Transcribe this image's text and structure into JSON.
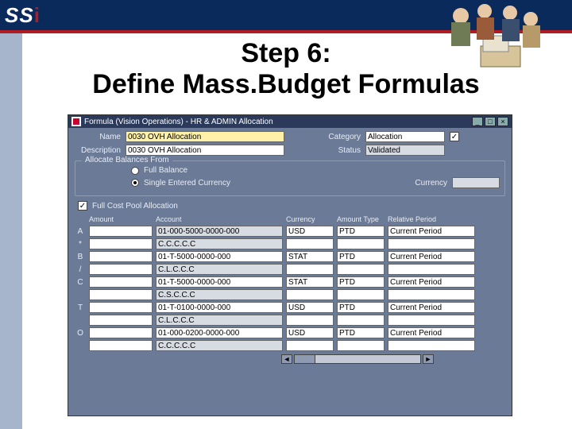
{
  "slide": {
    "logo": "SSi",
    "title_line1": "Step 6:",
    "title_line2": "Define Mass.Budget Formulas"
  },
  "window": {
    "title": "Formula (Vision Operations) - HR & ADMIN Allocation",
    "min": "_",
    "max": "□",
    "close": "×"
  },
  "header": {
    "name_label": "Name",
    "name_value": "0030 OVH Allocation",
    "category_label": "Category",
    "category_value": "Allocation",
    "description_label": "Description",
    "description_value": "0030 OVH Allocation",
    "status_label": "Status",
    "status_value": "Validated"
  },
  "allocate": {
    "legend": "Allocate Balances From",
    "full_balance": "Full Balance",
    "single_entered": "Single Entered Currency",
    "currency_label": "Currency",
    "currency_value": ""
  },
  "fullcost": {
    "label": "Full Cost Pool Allocation"
  },
  "grid": {
    "headers": {
      "amount": "Amount",
      "account": "Account",
      "currency": "Currency",
      "amount_type": "Amount Type",
      "relative_period": "Relative Period"
    },
    "rows": [
      {
        "lab": "A",
        "amount": "",
        "account": "01-000-5000-0000-000",
        "currency": "USD",
        "type": "PTD",
        "period": "Current Period",
        "acct_grey": true
      },
      {
        "lab": "*",
        "amount": "",
        "account": "C.C.C.C.C",
        "currency": "",
        "type": "",
        "period": "",
        "acct_grey": true
      },
      {
        "lab": "B",
        "amount": "",
        "account": "01-T-5000-0000-000",
        "currency": "STAT",
        "type": "PTD",
        "period": "Current Period",
        "acct_grey": false
      },
      {
        "lab": "/",
        "amount": "",
        "account": "C.L.C.C.C",
        "currency": "",
        "type": "",
        "period": "",
        "acct_grey": true
      },
      {
        "lab": "C",
        "amount": "",
        "account": "01-T-5000-0000-000",
        "currency": "STAT",
        "type": "PTD",
        "period": "Current Period",
        "acct_grey": false
      },
      {
        "lab": "",
        "amount": "",
        "account": "C.S.C.C.C",
        "currency": "",
        "type": "",
        "period": "",
        "acct_grey": true
      },
      {
        "lab": "T",
        "amount": "",
        "account": "01-T-0100-0000-000",
        "currency": "USD",
        "type": "PTD",
        "period": "Current Period",
        "acct_grey": false
      },
      {
        "lab": "",
        "amount": "",
        "account": "C.L.C.C.C",
        "currency": "",
        "type": "",
        "period": "",
        "acct_grey": true
      },
      {
        "lab": "O",
        "amount": "",
        "account": "01-000-0200-0000-000",
        "currency": "USD",
        "type": "PTD",
        "period": "Current Period",
        "acct_grey": false
      },
      {
        "lab": "",
        "amount": "",
        "account": "C.C.C.C.C",
        "currency": "",
        "type": "",
        "period": "",
        "acct_grey": true
      }
    ]
  }
}
